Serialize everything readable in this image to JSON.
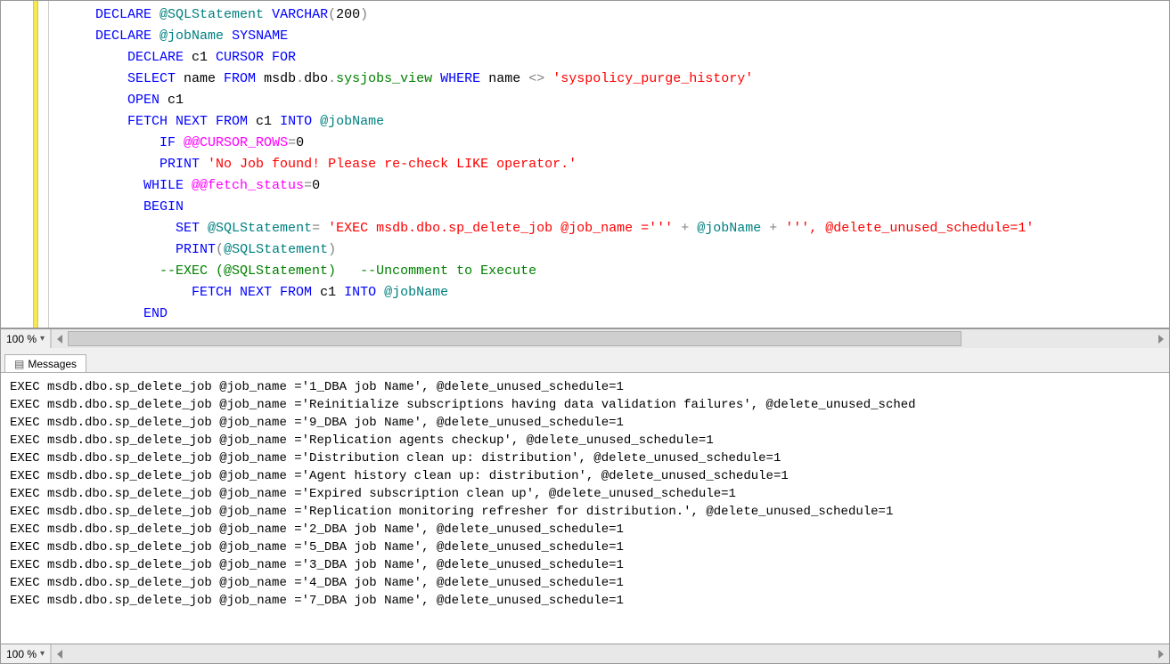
{
  "editor": {
    "zoom": "100 %",
    "tokens": [
      [
        [
          4,
          "clr-blue",
          "DECLARE "
        ],
        [
          0,
          "clr-teal",
          "@SQLStatement"
        ],
        [
          0,
          "",
          " "
        ],
        [
          0,
          "clr-blue",
          "VARCHAR"
        ],
        [
          0,
          "clr-gray",
          "("
        ],
        [
          0,
          "",
          "200"
        ],
        [
          0,
          "clr-gray",
          ")"
        ]
      ],
      [
        [
          4,
          "clr-blue",
          "DECLARE "
        ],
        [
          0,
          "clr-teal",
          "@jobName"
        ],
        [
          0,
          "",
          " "
        ],
        [
          0,
          "clr-blue",
          "SYSNAME"
        ]
      ],
      [
        [
          8,
          "clr-blue",
          "DECLARE "
        ],
        [
          0,
          "",
          "c1 "
        ],
        [
          0,
          "clr-blue",
          "CURSOR FOR"
        ]
      ],
      [
        [
          8,
          "clr-blue",
          "SELECT "
        ],
        [
          0,
          "",
          "name "
        ],
        [
          0,
          "clr-blue",
          "FROM "
        ],
        [
          0,
          "",
          "msdb"
        ],
        [
          0,
          "clr-gray",
          "."
        ],
        [
          0,
          "",
          "dbo"
        ],
        [
          0,
          "clr-gray",
          "."
        ],
        [
          0,
          "clr-green",
          "sysjobs_view"
        ],
        [
          0,
          "",
          " "
        ],
        [
          0,
          "clr-blue",
          "WHERE "
        ],
        [
          0,
          "",
          "name "
        ],
        [
          0,
          "clr-gray",
          "<>"
        ],
        [
          0,
          "",
          " "
        ],
        [
          0,
          "clr-red",
          "'syspolicy_purge_history'"
        ]
      ],
      [
        [
          8,
          "clr-blue",
          "OPEN "
        ],
        [
          0,
          "",
          "c1"
        ]
      ],
      [
        [
          8,
          "clr-blue",
          "FETCH NEXT FROM "
        ],
        [
          0,
          "",
          "c1 "
        ],
        [
          0,
          "clr-blue",
          "INTO "
        ],
        [
          0,
          "clr-teal",
          "@jobName"
        ]
      ],
      [
        [
          12,
          "clr-blue",
          "IF "
        ],
        [
          0,
          "clr-pink",
          "@@CURSOR_ROWS"
        ],
        [
          0,
          "clr-gray",
          "="
        ],
        [
          0,
          "",
          "0"
        ]
      ],
      [
        [
          12,
          "clr-blue",
          "PRINT "
        ],
        [
          0,
          "clr-red",
          "'No Job found! Please re-check LIKE operator.'"
        ]
      ],
      [
        [
          10,
          "clr-blue",
          "WHILE "
        ],
        [
          0,
          "clr-pink",
          "@@fetch_status"
        ],
        [
          0,
          "clr-gray",
          "="
        ],
        [
          0,
          "",
          "0"
        ]
      ],
      [
        [
          10,
          "clr-blue",
          "BEGIN"
        ]
      ],
      [
        [
          14,
          "clr-blue",
          "SET "
        ],
        [
          0,
          "clr-teal",
          "@SQLStatement"
        ],
        [
          0,
          "clr-gray",
          "="
        ],
        [
          0,
          "",
          " "
        ],
        [
          0,
          "clr-red",
          "'EXEC msdb.dbo.sp_delete_job @job_name ='''"
        ],
        [
          0,
          "",
          " "
        ],
        [
          0,
          "clr-gray",
          "+"
        ],
        [
          0,
          "",
          " "
        ],
        [
          0,
          "clr-teal",
          "@jobName"
        ],
        [
          0,
          "",
          " "
        ],
        [
          0,
          "clr-gray",
          "+"
        ],
        [
          0,
          "",
          " "
        ],
        [
          0,
          "clr-red",
          "''', @delete_unused_schedule=1'"
        ]
      ],
      [
        [
          14,
          "clr-blue",
          "PRINT"
        ],
        [
          0,
          "clr-gray",
          "("
        ],
        [
          0,
          "clr-teal",
          "@SQLStatement"
        ],
        [
          0,
          "clr-gray",
          ")"
        ]
      ],
      [
        [
          12,
          "clr-green",
          "--EXEC (@SQLStatement)   --Uncomment to Execute"
        ]
      ],
      [
        [
          16,
          "clr-blue",
          "FETCH NEXT FROM "
        ],
        [
          0,
          "",
          "c1 "
        ],
        [
          0,
          "clr-blue",
          "INTO "
        ],
        [
          0,
          "clr-teal",
          "@jobName"
        ]
      ],
      [
        [
          10,
          "clr-blue",
          "END"
        ]
      ]
    ]
  },
  "results": {
    "tab_label": "Messages",
    "zoom": "100 %",
    "lines": [
      "EXEC msdb.dbo.sp_delete_job @job_name ='1_DBA job Name', @delete_unused_schedule=1",
      "EXEC msdb.dbo.sp_delete_job @job_name ='Reinitialize subscriptions having data validation failures', @delete_unused_sched",
      "EXEC msdb.dbo.sp_delete_job @job_name ='9_DBA job Name', @delete_unused_schedule=1",
      "EXEC msdb.dbo.sp_delete_job @job_name ='Replication agents checkup', @delete_unused_schedule=1",
      "EXEC msdb.dbo.sp_delete_job @job_name ='Distribution clean up: distribution', @delete_unused_schedule=1",
      "EXEC msdb.dbo.sp_delete_job @job_name ='Agent history clean up: distribution', @delete_unused_schedule=1",
      "EXEC msdb.dbo.sp_delete_job @job_name ='Expired subscription clean up', @delete_unused_schedule=1",
      "EXEC msdb.dbo.sp_delete_job @job_name ='Replication monitoring refresher for distribution.', @delete_unused_schedule=1",
      "EXEC msdb.dbo.sp_delete_job @job_name ='2_DBA job Name', @delete_unused_schedule=1",
      "EXEC msdb.dbo.sp_delete_job @job_name ='5_DBA job Name', @delete_unused_schedule=1",
      "EXEC msdb.dbo.sp_delete_job @job_name ='3_DBA job Name', @delete_unused_schedule=1",
      "EXEC msdb.dbo.sp_delete_job @job_name ='4_DBA job Name', @delete_unused_schedule=1",
      "EXEC msdb.dbo.sp_delete_job @job_name ='7_DBA job Name', @delete_unused_schedule=1"
    ]
  }
}
